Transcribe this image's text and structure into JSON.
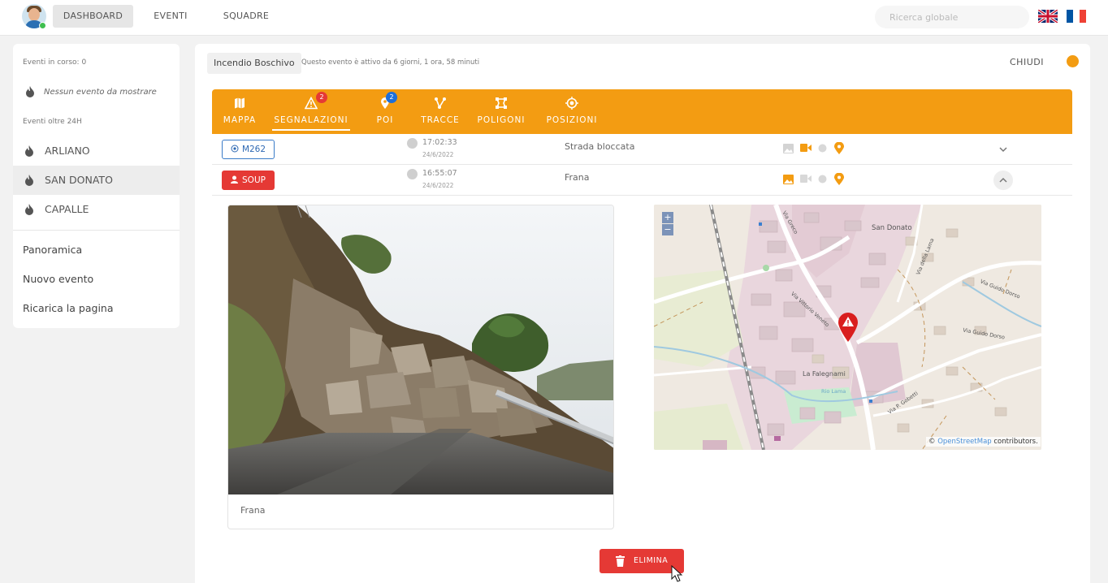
{
  "nav": {
    "dashboard": "DASHBOARD",
    "eventi": "EVENTI",
    "squadre": "SQUADRE"
  },
  "search": {
    "placeholder": "Ricerca globale"
  },
  "sidebar": {
    "events_ongoing": "Eventi in corso: 0",
    "no_events": "Nessun evento da mostrare",
    "events_24h": "Eventi oltre 24H",
    "items": [
      {
        "label": "ARLIANO"
      },
      {
        "label": "SAN DONATO"
      },
      {
        "label": "CAPALLE"
      }
    ],
    "links": [
      {
        "label": "Panoramica"
      },
      {
        "label": "Nuovo evento"
      },
      {
        "label": "Ricarica la pagina"
      }
    ]
  },
  "event": {
    "name": "Incendio Boschivo",
    "status": "Questo evento è attivo da 6 giorni, 1 ora, 58 minuti",
    "close": "CHIUDI"
  },
  "tabs": [
    {
      "label": "MAPPA",
      "icon": "map-icon"
    },
    {
      "label": "SEGNALAZIONI",
      "icon": "warning-icon",
      "badge": "2"
    },
    {
      "label": "POI",
      "icon": "poi-icon",
      "badge": "2"
    },
    {
      "label": "TRACCE",
      "icon": "tracks-icon"
    },
    {
      "label": "POLIGONI",
      "icon": "polygon-icon"
    },
    {
      "label": "POSIZIONI",
      "icon": "position-icon"
    }
  ],
  "reports": [
    {
      "tag": "M262",
      "time": "17:02:33",
      "date": "24/6/2022",
      "desc": "Strada bloccata"
    },
    {
      "tag": "SOUP",
      "time": "16:55:07",
      "date": "24/6/2022",
      "desc": "Frana"
    }
  ],
  "photo": {
    "caption": "Frana"
  },
  "map": {
    "zoom_in": "+",
    "zoom_out": "−",
    "labels": {
      "san_donato": "San Donato",
      "falegnami": "La Falegnami",
      "via_vittorio_veneto": "Via Vittorio Veneto",
      "via_guido_dorso_1": "Via Guido Dorso",
      "via_guido_dorso_2": "Via Guido Dorso",
      "via_della_lama": "Via della Lama",
      "via_greco": "Via Greco",
      "via_p_gobetti": "Via P. Gobetti",
      "rio_lama": "Rio Lama"
    },
    "attribution_prefix": "©",
    "attribution_link": "OpenStreetMap",
    "attribution_suffix": "contributors."
  },
  "actions": {
    "delete": "ELIMINA"
  },
  "colors": {
    "accent": "#f39c12",
    "danger": "#e53935",
    "link": "#2f69b3",
    "badge_red": "#e53935",
    "badge_blue": "#1e6fd9"
  }
}
